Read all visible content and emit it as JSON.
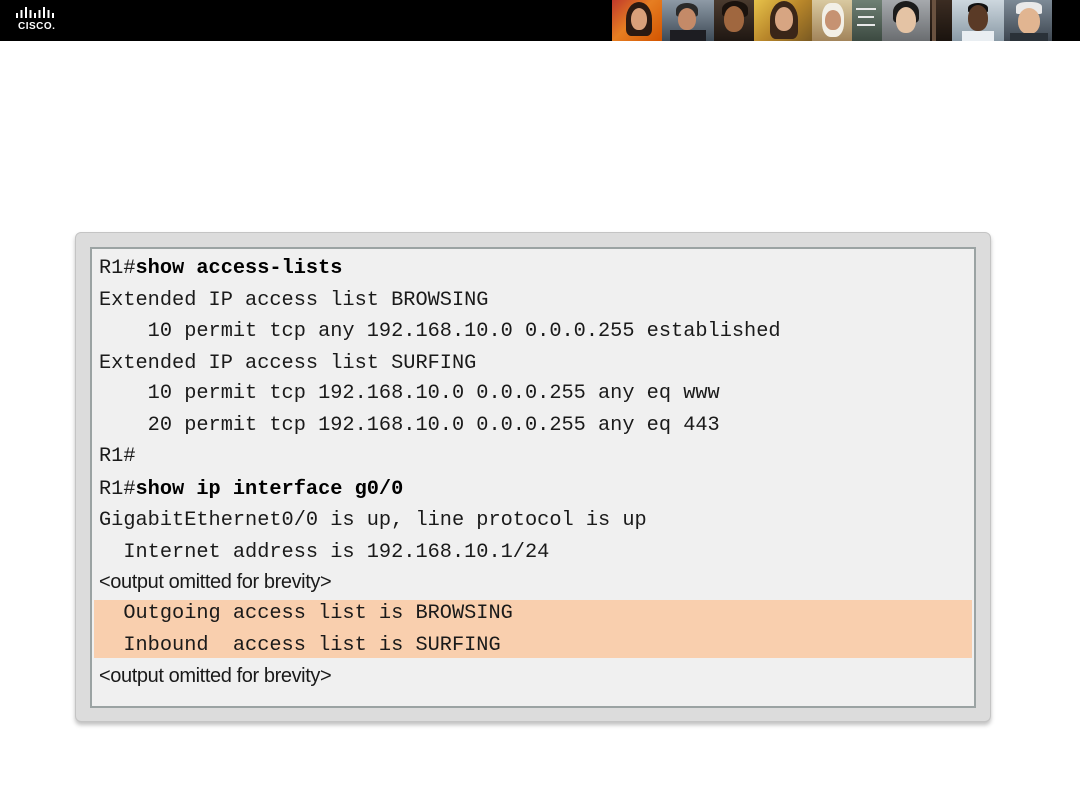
{
  "header": {
    "logo_text": "CISCO.",
    "background": "#000000"
  },
  "terminal": {
    "lines": [
      {
        "prompt": "R1#",
        "command": "show access-lists"
      },
      {
        "text": "Extended IP access list BROWSING"
      },
      {
        "text": "    10 permit tcp any 192.168.10.0 0.0.0.255 established"
      },
      {
        "text": "Extended IP access list SURFING"
      },
      {
        "text": "    10 permit tcp 192.168.10.0 0.0.0.255 any eq www"
      },
      {
        "text": "    20 permit tcp 192.168.10.0 0.0.0.255 any eq 443"
      },
      {
        "text": "R1#"
      },
      {
        "prompt": "R1#",
        "command": "show ip interface g0/0"
      },
      {
        "text": "GigabitEthernet0/0 is up, line protocol is up"
      },
      {
        "text": "  Internet address is 192.168.10.1/24"
      },
      {
        "note": "<output omitted for brevity>"
      },
      {
        "text": "  Outgoing access list is BROWSING"
      },
      {
        "text": "  Inbound  access list is SURFING"
      },
      {
        "note": "<output omitted for brevity>"
      }
    ],
    "highlight_color": "#f9cfae"
  }
}
